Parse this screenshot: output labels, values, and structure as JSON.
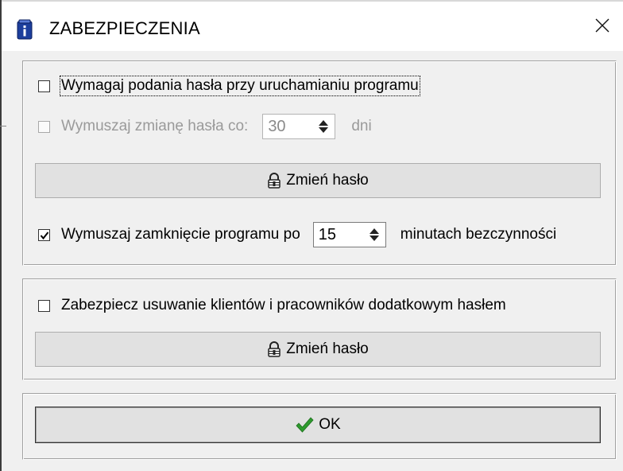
{
  "window": {
    "title": "ZABEZPIECZENIA",
    "close_label": "×"
  },
  "program_password": {
    "require_label": "Wymagaj podania hasła przy uruchamianiu programu",
    "require_checked": false,
    "force_change_label": "Wymuszaj zmianę hasła co:",
    "force_change_checked": false,
    "force_change_enabled": false,
    "force_change_days": "30",
    "days_unit": "dni",
    "change_password_label": "Zmień hasło",
    "force_close_label": "Wymuszaj zamknięcie programu po",
    "force_close_checked": true,
    "force_close_minutes": "15",
    "minutes_unit": "minutach bezczynności"
  },
  "delete_protection": {
    "label": "Zabezpiecz usuwanie klientów i pracowników dodatkowym hasłem",
    "checked": false,
    "change_password_label": "Zmień hasło"
  },
  "footer": {
    "ok_label": "OK"
  },
  "icons": {
    "app": "info-book-icon",
    "close": "close-icon",
    "lock": "lock-icon",
    "ok": "checkmark-icon",
    "spin": "spin-arrows-icon"
  },
  "colors": {
    "titlebar_bg": "#ffffff",
    "window_bg": "#f0f0f0",
    "button_bg": "#e1e1e1",
    "checkmark_green": "#2e9a2e",
    "app_icon_blue": "#1c3e9c",
    "disabled_text": "#9a9a9a"
  }
}
